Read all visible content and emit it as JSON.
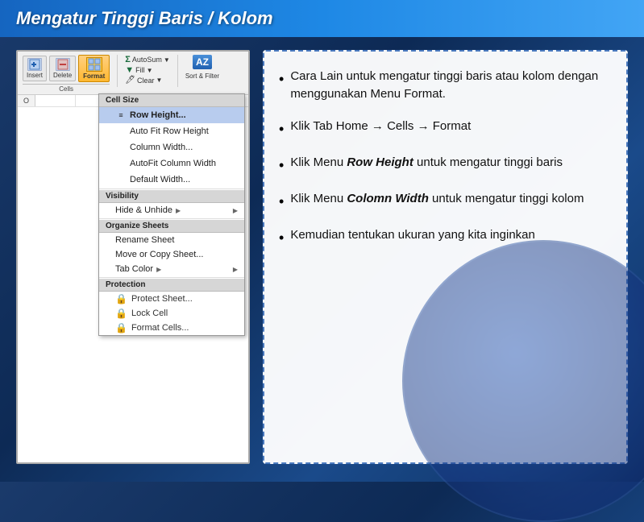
{
  "title": "Mengatur Tinggi Baris / Kolom",
  "ribbon": {
    "insert_label": "Insert",
    "delete_label": "Delete",
    "format_label": "Format",
    "cells_label": "Cells",
    "autosum_label": "AutoSum",
    "fill_label": "Fill",
    "clear_label": "Clear",
    "sort_filter_label": "Sort & Filter"
  },
  "dropdown": {
    "cell_size_header": "Cell Size",
    "row_height": "Row Height...",
    "autofit_row": "Auto Fit Row Height",
    "column_width": "Column Width...",
    "autofit_col": "AutoFit Column Width",
    "default_width": "Default Width...",
    "visibility_header": "Visibility",
    "hide_unhide": "Hide & Unhide",
    "organize_header": "Organize Sheets",
    "rename_sheet": "Rename Sheet",
    "move_copy": "Move or Copy Sheet...",
    "tab_color": "Tab Color",
    "protection_header": "Protection",
    "protect_sheet": "Protect Sheet...",
    "lock_cell": "Lock Cell",
    "format_cells": "Format Cells..."
  },
  "bullets": {
    "bullet1": "Cara Lain untuk mengatur tinggi baris atau kolom dengan menggunakan Menu Format.",
    "bullet2": "Klik Tab Home → Cells → Format",
    "bullet3_pre": "Klik Menu ",
    "bullet3_italic": "Row Height",
    "bullet3_post": " untuk mengatur tinggi baris",
    "bullet4_pre": "Klik Menu ",
    "bullet4_italic": "Colomn Width",
    "bullet4_post": " untuk mengatur tinggi kolom",
    "bullet5": "Kemudian tentukan ukuran yang kita inginkan"
  }
}
